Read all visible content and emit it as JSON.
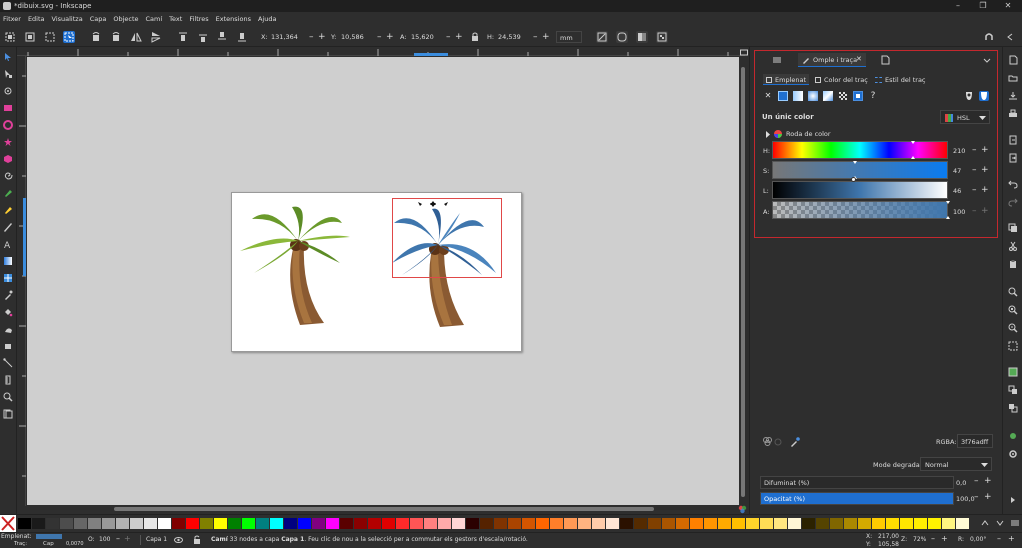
{
  "window": {
    "title": "*dibuix.svg - Inkscape",
    "minimize": "–",
    "maximize": "❐",
    "close": "✕"
  },
  "menu": [
    "Fitxer",
    "Edita",
    "Visualitza",
    "Capa",
    "Objecte",
    "Camí",
    "Text",
    "Filtres",
    "Extensions",
    "Ajuda"
  ],
  "toolbar": {
    "x_label": "X:",
    "x_value": "131,364",
    "y_label": "Y:",
    "y_value": "10,586",
    "w_label": "A:",
    "w_value": "15,620",
    "h_label": "H:",
    "h_value": "24,539",
    "unit": "mm",
    "minus": "–",
    "plus": "+"
  },
  "dock": {
    "tab_label": "Omple i traça",
    "subtabs": [
      "Emplenat",
      "Color del traç",
      "Estil del traç"
    ],
    "flat_color_title": "Un únic color",
    "color_mode": "HSL",
    "color_wheel_label": "Roda de color",
    "sliders": [
      {
        "label": "H:",
        "value": "210",
        "fraction": 0.8
      },
      {
        "label": "S:",
        "value": "47",
        "fraction": 0.47
      },
      {
        "label": "L:",
        "value": "46",
        "fraction": 0.46
      },
      {
        "label": "A:",
        "value": "100",
        "fraction": 1.0
      }
    ],
    "rgba_label": "RGBA:",
    "rgba_value": "3f76adff",
    "blend_label": "Mode degradat:",
    "blend_value": "Normal",
    "blur_label": "Difuminat (%)",
    "blur_value": "0,0",
    "opacity_label": "Opacitat (%)",
    "opacity_value": "100,0",
    "opacity_fraction": 1.0,
    "unknown_mark": "?"
  },
  "status": {
    "fill_label": "Emplenat:",
    "stroke_label": "Traç:",
    "stroke_value": "Cap",
    "stroke_width": "0,0070",
    "opacity_label": "O:",
    "opacity_value": "100",
    "layer": "Capa 1",
    "message_bold": "Camí",
    "message_mid": " 33 nodes a capa ",
    "message_layer": "Capa 1",
    "message_tail": ". Feu clic de nou a la selecció per a commutar els gestors d'escala/rotació.",
    "x_label": "X:",
    "x_value": "217,00",
    "y_label": "Y:",
    "y_value": "105,58",
    "zoom_label": "Z:",
    "zoom_value": "72%",
    "rot_label": "R:",
    "rot_value": "0,00°"
  },
  "colors": {
    "accent": "#1f6fd0",
    "selection": "#e04848",
    "palette": [
      "#000000",
      "#1a1a1a",
      "#333333",
      "#4d4d4d",
      "#666666",
      "#808080",
      "#999999",
      "#b3b3b3",
      "#cccccc",
      "#e6e6e6",
      "#ffffff",
      "#800000",
      "#ff0000",
      "#808000",
      "#ffff00",
      "#008000",
      "#00ff00",
      "#008080",
      "#00ffff",
      "#000080",
      "#0000ff",
      "#800080",
      "#ff00ff",
      "#5a0000",
      "#8a0000",
      "#b40000",
      "#e00000",
      "#ff2a2a",
      "#ff5555",
      "#ff8080",
      "#ffaaaa",
      "#ffd5d5",
      "#2b0000",
      "#552200",
      "#803300",
      "#aa4400",
      "#d45500",
      "#ff6600",
      "#ff7f2a",
      "#ff9955",
      "#ffb380",
      "#ffccaa",
      "#ffe6d5",
      "#2b1100",
      "#552b00",
      "#804000",
      "#aa5500",
      "#d46a00",
      "#ff8000",
      "#ff9500",
      "#ffaa00",
      "#ffbf00",
      "#ffd42a",
      "#ffdd55",
      "#ffe680",
      "#fff6d5",
      "#2b2200",
      "#554400",
      "#806600",
      "#aa8800",
      "#d4aa00",
      "#ffcc00",
      "#ffdd00",
      "#ffe600",
      "#ffee00",
      "#fff200",
      "#fff680",
      "#fffbd5"
    ]
  }
}
